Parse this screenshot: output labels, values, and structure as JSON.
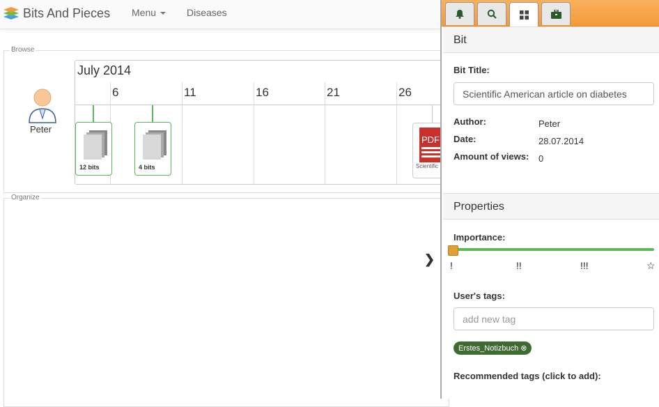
{
  "navbar": {
    "brand": "Bits And Pieces",
    "menu_label": "Menu",
    "diseases_label": "Diseases"
  },
  "browse": {
    "legend": "Browse",
    "user_name": "Peter",
    "month": "July 2014",
    "days": [
      "6",
      "11",
      "16",
      "21",
      "26"
    ],
    "cards": [
      {
        "label": "12 bits"
      },
      {
        "label": "4 bits"
      }
    ],
    "pdf_card": {
      "icon_text": "PDF",
      "label": "Scientific"
    }
  },
  "organize": {
    "legend": "Organize"
  },
  "panel": {
    "tabs": [
      {
        "icon": "bell-icon"
      },
      {
        "icon": "search-icon"
      },
      {
        "icon": "grid-icon"
      },
      {
        "icon": "briefcase-icon"
      }
    ],
    "bit": {
      "header": "Bit",
      "title_label": "Bit Title:",
      "title_value": "Scientific American article on diabetes",
      "author_label": "Author:",
      "author_value": "Peter",
      "date_label": "Date:",
      "date_value": "28.07.2014",
      "views_label": "Amount of views:",
      "views_value": "0"
    },
    "properties": {
      "header": "Properties",
      "importance_label": "Importance:",
      "importance_level": 0,
      "importance_ticks": [
        "!",
        "!!",
        "!!!",
        "☆"
      ],
      "tags_label": "User's tags:",
      "tag_placeholder": "add new tag",
      "tags": [
        "Erstes_Notizbuch ⊗"
      ],
      "recommended_label": "Recommended tags (click to add):"
    }
  },
  "colors": {
    "accent_orange": "#f39a3a",
    "green": "#5cb85c",
    "tag_green": "#3f6b33",
    "handle": "#e0a030"
  }
}
